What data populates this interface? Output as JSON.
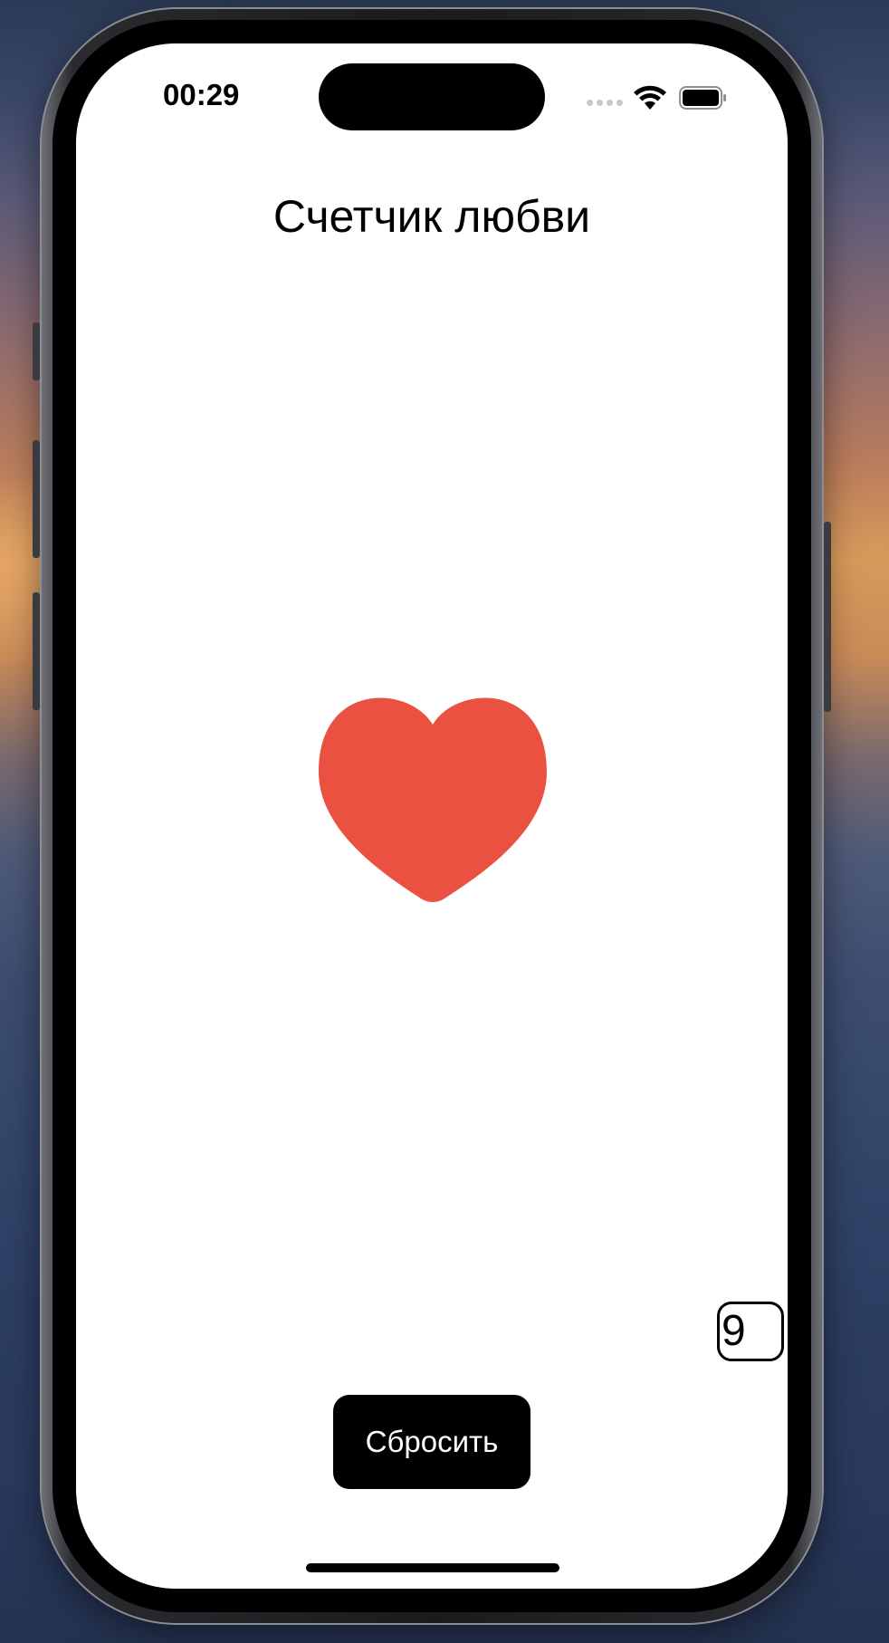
{
  "status_bar": {
    "time": "00:29",
    "wifi_icon": "wifi-icon",
    "battery_icon": "battery-icon",
    "signal_icon": "cellular-signal-icon"
  },
  "app": {
    "title": "Счетчик любви",
    "heart_icon": "heart-icon",
    "heart_color": "#EA5140",
    "counter_value": "9",
    "reset_label": "Сбросить"
  }
}
